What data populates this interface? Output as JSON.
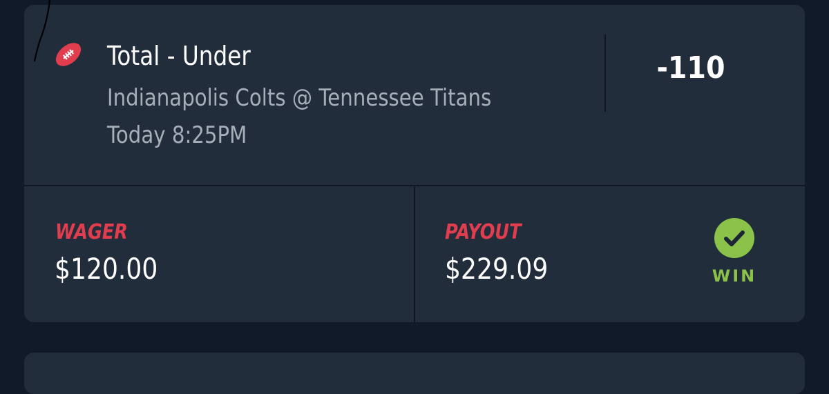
{
  "bet": {
    "title": "Total - Under",
    "matchup": "Indianapolis Colts @ Tennessee Titans",
    "time": "Today 8:25PM",
    "odds": "-110",
    "sport_icon": "football-icon"
  },
  "wager": {
    "label": "WAGER",
    "amount": "$120.00"
  },
  "payout": {
    "label": "PAYOUT",
    "amount": "$229.09"
  },
  "result": {
    "label": "WIN",
    "icon": "check-circle-icon",
    "color": "#8bc34a"
  },
  "colors": {
    "background": "#101a28",
    "card": "#222d3c",
    "accent_red": "#e03d4e",
    "win_green": "#8bc34a",
    "muted_text": "#a6aeb8"
  }
}
